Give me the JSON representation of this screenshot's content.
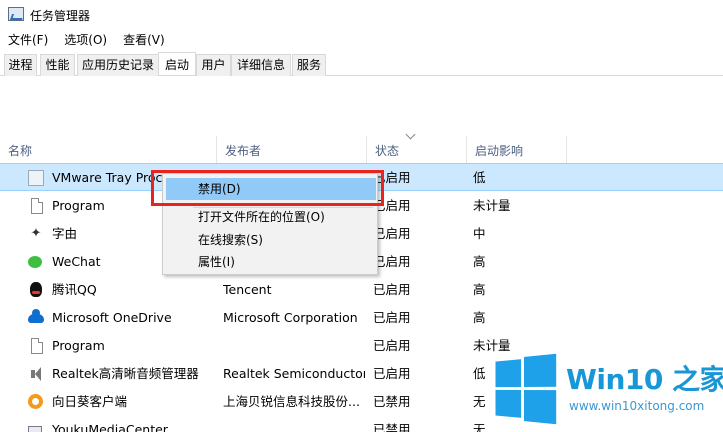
{
  "window": {
    "title": "任务管理器"
  },
  "menu": [
    "文件(F)",
    "选项(O)",
    "查看(V)"
  ],
  "tabs": [
    "进程",
    "性能",
    "应用历史记录",
    "启动",
    "用户",
    "详细信息",
    "服务"
  ],
  "active_tab": "启动",
  "columns": {
    "name": "名称",
    "publisher": "发布者",
    "status": "状态",
    "impact": "启动影响"
  },
  "rows": [
    {
      "icon": "vmware-tray-icon",
      "name": "VMware Tray Proce",
      "publisher": "",
      "status": "已启用",
      "impact": "低",
      "selected": true
    },
    {
      "icon": "document-icon",
      "name": "Program",
      "publisher": "",
      "status": "已启用",
      "impact": "未计量"
    },
    {
      "icon": "star-icon",
      "name": "字由",
      "publisher": "",
      "status": "已启用",
      "impact": "中"
    },
    {
      "icon": "wechat-icon",
      "name": "WeChat",
      "publisher": "",
      "status": "已启用",
      "impact": "高"
    },
    {
      "icon": "qq-penguin-icon",
      "name": "腾讯QQ",
      "publisher": "Tencent",
      "status": "已启用",
      "impact": "高"
    },
    {
      "icon": "onedrive-cloud-icon",
      "name": "Microsoft OneDrive",
      "publisher": "Microsoft Corporation",
      "status": "已启用",
      "impact": "高"
    },
    {
      "icon": "document-icon",
      "name": "Program",
      "publisher": "",
      "status": "已启用",
      "impact": "未计量"
    },
    {
      "icon": "speaker-icon",
      "name": "Realtek高清晰音频管理器",
      "publisher": "Realtek Semiconductor",
      "status": "已启用",
      "impact": "低"
    },
    {
      "icon": "sunflower-icon",
      "name": "向日葵客户端",
      "publisher": "上海贝锐信息科技股份...",
      "status": "已禁用",
      "impact": "无"
    },
    {
      "icon": "youku-icon",
      "name": "YoukuMediaCenter",
      "publisher": "",
      "status": "已禁用",
      "impact": "无"
    }
  ],
  "context_menu": {
    "items": [
      "禁用(D)",
      "打开文件所在的位置(O)",
      "在线搜索(S)",
      "属性(I)"
    ],
    "highlighted": "禁用(D)"
  },
  "watermark": {
    "title": "Win10 之家",
    "url": "www.win10xitong.com"
  }
}
